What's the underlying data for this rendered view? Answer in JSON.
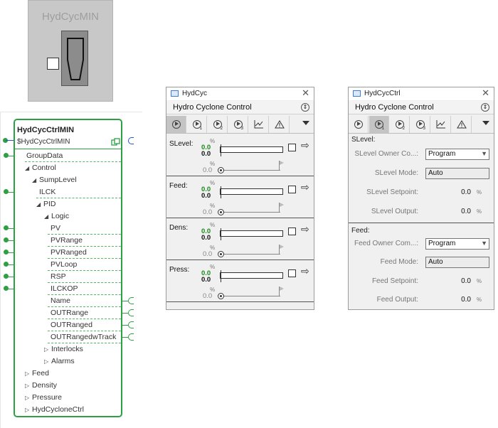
{
  "icon_block": {
    "title": "HydCycMIN"
  },
  "function_block": {
    "title": "HydCycCtrlMIN",
    "instance": "$HydCycCtrlMIN",
    "rows": [
      {
        "label": "GroupData",
        "indent": 0,
        "caret": ""
      },
      {
        "label": "Control",
        "indent": 0,
        "caret": "◢"
      },
      {
        "label": "SumpLevel",
        "indent": 1,
        "caret": "◢"
      },
      {
        "label": "ILCK",
        "indent": 2,
        "caret": ""
      },
      {
        "label": "PID",
        "indent": 2,
        "caret": "◢"
      },
      {
        "label": "Logic",
        "indent": 3,
        "caret": "◢"
      },
      {
        "label": "PV",
        "indent": 4,
        "caret": ""
      },
      {
        "label": "PVRange",
        "indent": 4,
        "caret": ""
      },
      {
        "label": "PVRanged",
        "indent": 4,
        "caret": ""
      },
      {
        "label": "PVLoop",
        "indent": 4,
        "caret": ""
      },
      {
        "label": "RSP",
        "indent": 4,
        "caret": ""
      },
      {
        "label": "ILCKOP",
        "indent": 4,
        "caret": ""
      },
      {
        "label": "Name",
        "indent": 4,
        "caret": ""
      },
      {
        "label": "OUTRange",
        "indent": 4,
        "caret": ""
      },
      {
        "label": "OUTRanged",
        "indent": 4,
        "caret": ""
      },
      {
        "label": "OUTRangedwTrack",
        "indent": 4,
        "caret": ""
      },
      {
        "label": "Interlocks",
        "indent": 3,
        "caret": "▷"
      },
      {
        "label": "Alarms",
        "indent": 3,
        "caret": "▷"
      },
      {
        "label": "Feed",
        "indent": 0,
        "caret": "▷"
      },
      {
        "label": "Density",
        "indent": 0,
        "caret": "▷"
      },
      {
        "label": "Pressure",
        "indent": 0,
        "caret": "▷"
      },
      {
        "label": "HydCycloneCtrl",
        "indent": 0,
        "caret": "▷"
      }
    ]
  },
  "faceplate1": {
    "window_title": "HydCyc",
    "header": "Hydro Cyclone Control",
    "tabs": [
      "",
      "1",
      "2",
      "3"
    ],
    "sections": [
      {
        "label": "SLevel:",
        "unit": "%",
        "value_green": "0.0",
        "value_black": "0.0",
        "setpoint": "0.0"
      },
      {
        "label": "Feed:",
        "unit": "%",
        "value_green": "0.0",
        "value_black": "0.0",
        "setpoint": "0.0"
      },
      {
        "label": "Dens:",
        "unit": "%",
        "value_green": "0.0",
        "value_black": "0.0",
        "setpoint": "0.0"
      },
      {
        "label": "Press:",
        "unit": "%",
        "value_green": "0.0",
        "value_black": "0.0",
        "setpoint": "0.0"
      }
    ]
  },
  "faceplate2": {
    "window_title": "HydCycCtrl",
    "header": "Hydro Cyclone Control",
    "tabs": [
      "",
      "1",
      "2",
      "3"
    ],
    "slevel": {
      "section": "SLevel:",
      "owner_label": "SLevel Owner Co...:",
      "owner_value": "Program",
      "mode_label": "SLevel Mode:",
      "mode_value": "Auto",
      "setpoint_label": "SLevel Setpoint:",
      "setpoint_value": "0.0",
      "output_label": "SLevel Output:",
      "output_value": "0.0",
      "unit": "%"
    },
    "feed": {
      "section": "Feed:",
      "owner_label": "Feed Owner Com...:",
      "owner_value": "Program",
      "mode_label": "Feed Mode:",
      "mode_value": "Auto",
      "setpoint_label": "Feed Setpoint:",
      "setpoint_value": "0.0",
      "output_label": "Feed Output:",
      "output_value": "0.0",
      "unit": "%"
    }
  }
}
